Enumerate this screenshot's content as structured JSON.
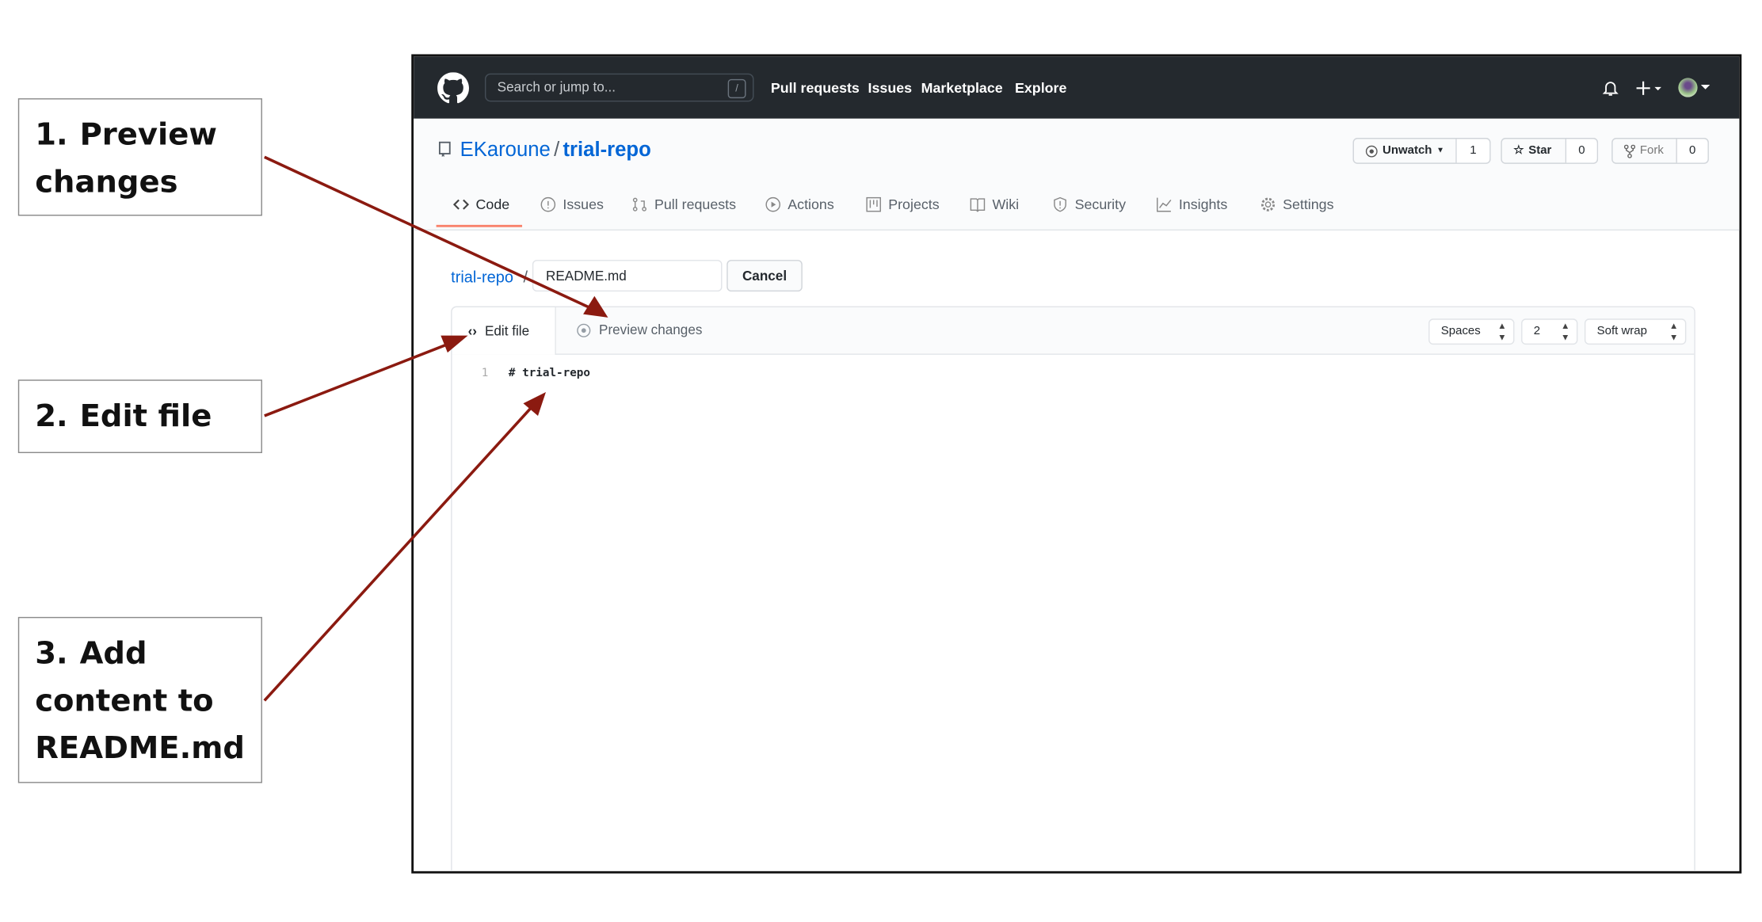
{
  "callouts": [
    {
      "number": "1.",
      "text": "Preview changes"
    },
    {
      "number": "2.",
      "text": "Edit file"
    },
    {
      "number": "3.",
      "text": "Add content to README.md"
    }
  ],
  "header": {
    "search_placeholder": "Search or jump to...",
    "search_shortcut": "/",
    "nav": [
      "Pull requests",
      "Issues",
      "Marketplace",
      "Explore"
    ]
  },
  "repo": {
    "owner": "EKaroune",
    "separator": "/",
    "name": "trial-repo"
  },
  "actions": {
    "watch": {
      "label": "Unwatch",
      "count": "1"
    },
    "star": {
      "label": "Star",
      "count": "0"
    },
    "fork": {
      "label": "Fork",
      "count": "0"
    }
  },
  "tabs": [
    {
      "label": "Code",
      "icon": "code-icon"
    },
    {
      "label": "Issues",
      "icon": "issue-icon"
    },
    {
      "label": "Pull requests",
      "icon": "pull-request-icon"
    },
    {
      "label": "Actions",
      "icon": "play-icon"
    },
    {
      "label": "Projects",
      "icon": "project-icon"
    },
    {
      "label": "Wiki",
      "icon": "book-icon"
    },
    {
      "label": "Security",
      "icon": "shield-icon"
    },
    {
      "label": "Insights",
      "icon": "graph-icon"
    },
    {
      "label": "Settings",
      "icon": "gear-icon"
    }
  ],
  "editor": {
    "breadcrumb_repo": "trial-repo",
    "breadcrumb_sep": "/",
    "filename": "README.md",
    "cancel": "Cancel",
    "edit_tab": "Edit file",
    "preview_tab": "Preview changes",
    "indent_mode": "Spaces",
    "indent_size": "2",
    "wrap_mode": "Soft wrap",
    "lines": [
      {
        "num": "1",
        "text": "# trial-repo"
      }
    ]
  },
  "colors": {
    "accent": "#0366d6",
    "header": "#24292e",
    "tab_underline": "#f9826c",
    "arrow": "#8b1a10"
  }
}
